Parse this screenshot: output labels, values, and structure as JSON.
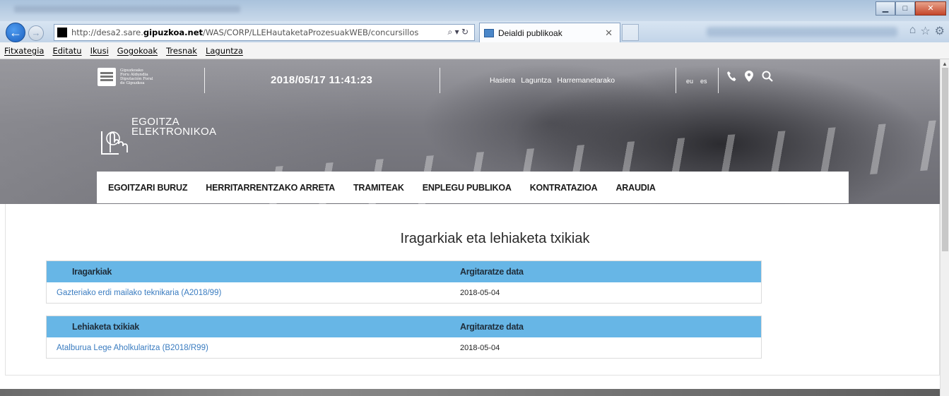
{
  "browser": {
    "url_prefix": "http://desa2.sare.",
    "url_domain": "gipuzkoa.net",
    "url_path": "/WAS/CORP/LLEHautaketaProzesuakWEB/concursillos",
    "tab_title": "Deialdi publikoak"
  },
  "menu": {
    "items": [
      "Fitxategia",
      "Editatu",
      "Ikusi",
      "Gogokoak",
      "Tresnak",
      "Laguntza"
    ]
  },
  "header": {
    "logo_lines": [
      "Gipuzkoako",
      "Foru Aldundia",
      "Diputación Foral",
      "de Gipuzkoa"
    ],
    "datetime": "2018/05/17 11:41:23",
    "top_links": [
      "Hasiera",
      "Laguntza",
      "Harremanetarako"
    ],
    "languages": [
      "eu",
      "es"
    ],
    "egoitza_line1": "EGOITZA",
    "egoitza_line2": "ELEKTRONIKOA"
  },
  "nav": {
    "items": [
      "EGOITZARI BURUZ",
      "HERRITARRENTZAKO ARRETA",
      "TRAMITEAK",
      "ENPLEGU PUBLIKOA",
      "KONTRATAZIOA",
      "ARAUDIA"
    ]
  },
  "main": {
    "title": "Iragarkiak eta lehiaketa txikiak",
    "tables": [
      {
        "headers": [
          "Iragarkiak",
          "Argitaratze data"
        ],
        "rows": [
          [
            "Gazteriako erdi mailako teknikaria (A2018/99)",
            "2018-05-04"
          ]
        ]
      },
      {
        "headers": [
          "Lehiaketa txikiak",
          "Argitaratze data"
        ],
        "rows": [
          [
            "Atalburua Lege Aholkularitza (B2018/R99)",
            "2018-05-04"
          ]
        ]
      }
    ]
  },
  "colors": {
    "table_header": "#67b6e6",
    "link": "#3a7cc0"
  },
  "icons": [
    "back-arrow-icon",
    "forward-arrow-icon",
    "search-icon",
    "refresh-icon",
    "home-icon",
    "star-icon",
    "gear-icon",
    "phone-icon",
    "location-pin-icon"
  ]
}
